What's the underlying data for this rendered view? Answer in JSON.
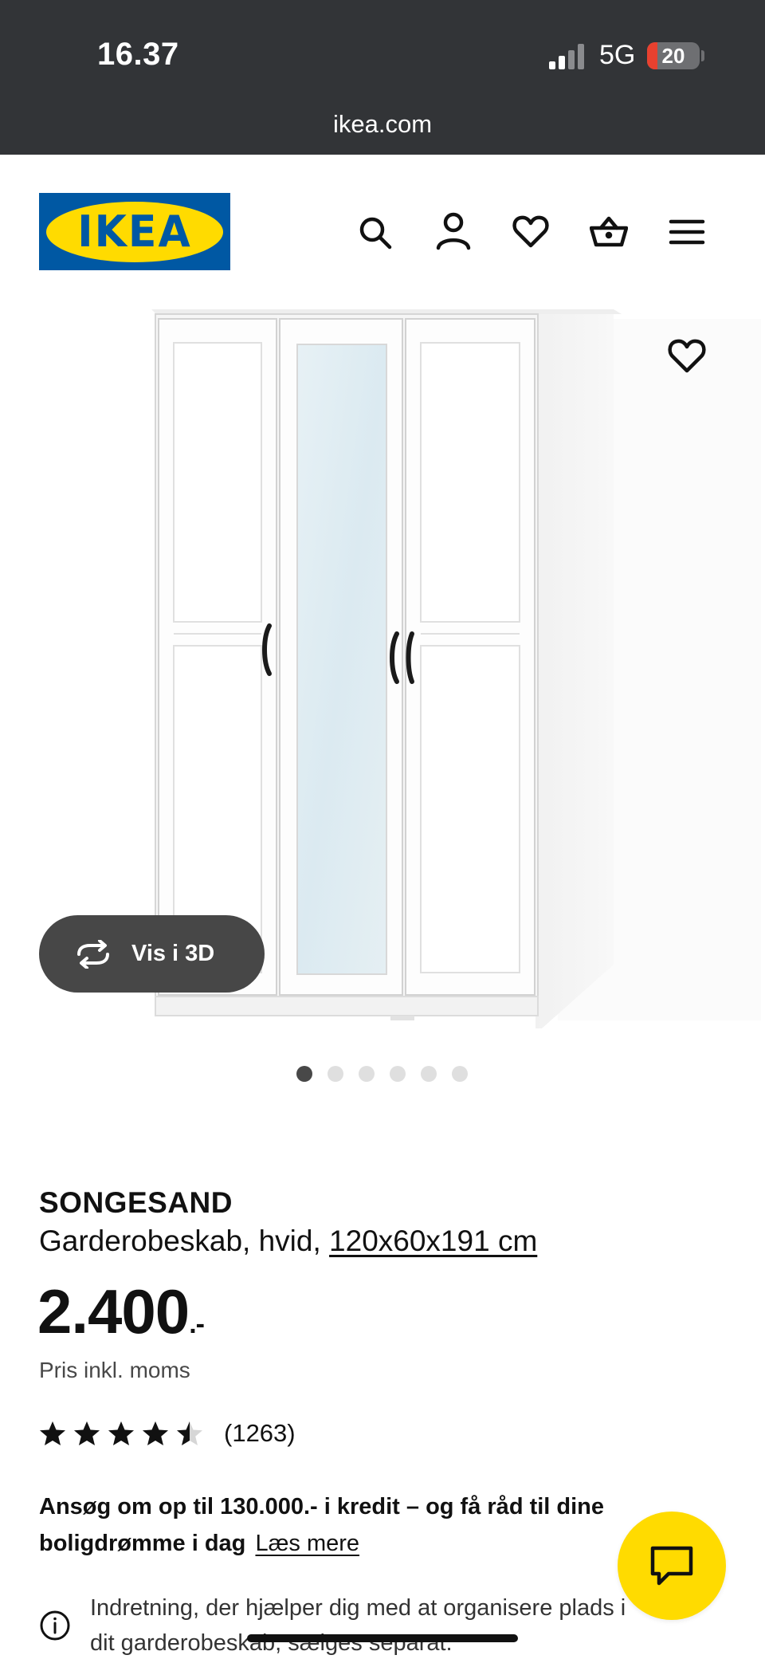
{
  "status_bar": {
    "time": "16.37",
    "network": "5G",
    "battery_level": "20",
    "battery_fraction": 0.2
  },
  "browser": {
    "url": "ikea.com"
  },
  "header": {
    "logo_text": "IKEA",
    "icons": [
      "search-icon",
      "account-icon",
      "favorites-icon",
      "basket-icon",
      "menu-icon"
    ]
  },
  "gallery": {
    "view_3d_label": "Vis i 3D",
    "image_count": 6,
    "active_index": 0
  },
  "product": {
    "name": "SONGESAND",
    "description": "Garderobeskab, hvid,",
    "size_link": "120x60x191 cm",
    "price_main": "2.400",
    "price_suffix": ".-",
    "price_note": "Pris inkl. moms",
    "rating_value": 4.5,
    "rating_count": "(1263)"
  },
  "credit": {
    "text": "Ansøg om op til 130.000.- i kredit – og få råd til dine boligdrømme i dag",
    "link": "Læs mere"
  },
  "info_notice": {
    "line1": "Indretning, der hjælper dig med at organisere plads i",
    "line2": "dit garderobeskab, sælges separat."
  },
  "colors": {
    "status_bg": "#323437",
    "ikea_blue": "#0058a3",
    "ikea_yellow": "#ffdb00",
    "button_dark": "#474747",
    "battery_red": "#e8412f"
  }
}
